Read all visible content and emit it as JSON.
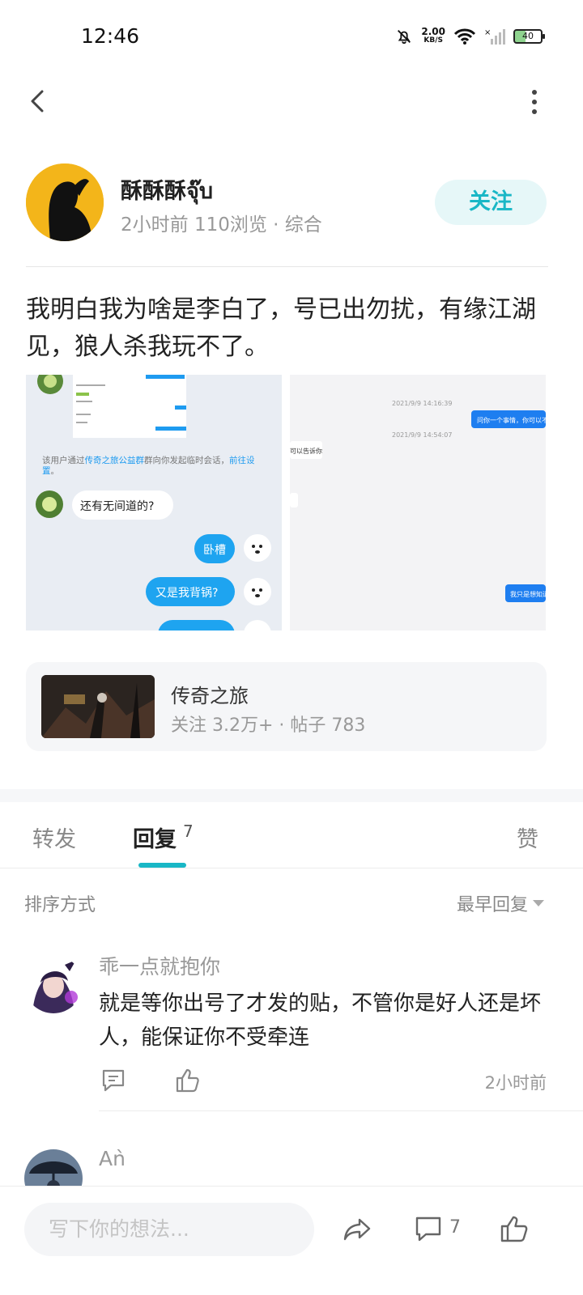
{
  "status_bar": {
    "time": "12:46",
    "net_speed": "2.00",
    "net_unit": "KB/S",
    "battery": "40"
  },
  "post": {
    "author": "酥酥酥จุ๊บ",
    "meta": "2小时前 110浏览 · 综合",
    "follow_label": "关注",
    "text": "我明白我为啥是李白了，号已出勿扰，有缘江湖见，狼人杀我玩不了。"
  },
  "screenshot1": {
    "notice_prefix": "该用户通过",
    "notice_group": "传奇之旅公益群",
    "notice_mid": "群向你发起临时会话，",
    "notice_link": "前往设置",
    "notice_end": "。",
    "msg_in": "还有无间道的?",
    "msg_out_1": "卧槽",
    "msg_out_2": "又是我背锅?"
  },
  "screenshot2": {
    "time_1": "2021/9/9 14:16:39",
    "msg_1": "问你一个事情，你可以不回",
    "time_2": "2021/9/9 14:54:07",
    "msg_2": "可以告诉你",
    "msg_3": "我只是想知道"
  },
  "game": {
    "name": "传奇之旅",
    "stats": "关注 3.2万+ · 帖子 783"
  },
  "tabs": {
    "forward": "转发",
    "reply": "回复",
    "reply_count": "7",
    "like": "赞"
  },
  "sort": {
    "label": "排序方式",
    "value": "最早回复"
  },
  "comments": [
    {
      "name": "乖一点就抱你",
      "text": "就是等你出号了才发的贴，不管你是好人还是坏人，能保证你不受牵连",
      "time": "2小时前"
    },
    {
      "name": "Aǹ"
    }
  ],
  "bottom_bar": {
    "placeholder": "写下你的想法...",
    "comment_count": "7"
  },
  "colors": {
    "accent": "#19b7c6",
    "qq_blue": "#1e9bf0"
  }
}
